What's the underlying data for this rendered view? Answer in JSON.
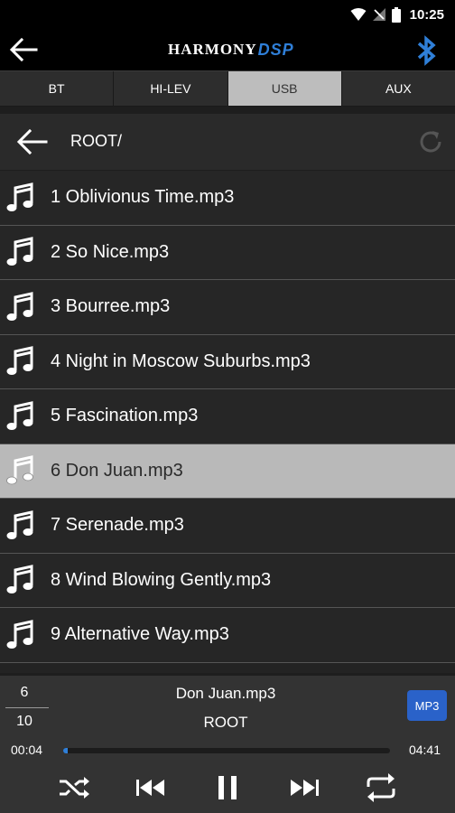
{
  "status_bar": {
    "time": "10:25"
  },
  "app_bar": {
    "logo_main": "HARMONY",
    "logo_accent": "DSP"
  },
  "tabs": [
    {
      "label": "BT",
      "active": false
    },
    {
      "label": "HI-LEV",
      "active": false
    },
    {
      "label": "USB",
      "active": true
    },
    {
      "label": "AUX",
      "active": false
    }
  ],
  "path": {
    "label": "ROOT/"
  },
  "files": [
    {
      "name": "1 Oblivionus Time.mp3",
      "selected": false
    },
    {
      "name": "2 So Nice.mp3",
      "selected": false
    },
    {
      "name": "3 Bourree.mp3",
      "selected": false
    },
    {
      "name": "4 Night in Moscow Suburbs.mp3",
      "selected": false
    },
    {
      "name": "5 Fascination.mp3",
      "selected": false
    },
    {
      "name": "6 Don Juan.mp3",
      "selected": true
    },
    {
      "name": "7 Serenade.mp3",
      "selected": false
    },
    {
      "name": "8 Wind Blowing Gently.mp3",
      "selected": false
    },
    {
      "name": "9 Alternative Way.mp3",
      "selected": false
    }
  ],
  "player": {
    "current_index": "6",
    "total_count": "10",
    "track_title": "Don Juan.mp3",
    "folder": "ROOT",
    "format_badge": "MP3",
    "elapsed": "00:04",
    "duration": "04:41",
    "progress_fraction": 0.014
  },
  "colors": {
    "accent": "#2f7fd8",
    "badge": "#2a62c9",
    "selected_row": "#b9b9b9",
    "active_tab": "#bdbdbd"
  },
  "icons": [
    "back-arrow-icon",
    "bluetooth-icon",
    "refresh-icon",
    "music-note-icon",
    "shuffle-icon",
    "previous-icon",
    "pause-icon",
    "next-icon",
    "repeat-icon"
  ]
}
